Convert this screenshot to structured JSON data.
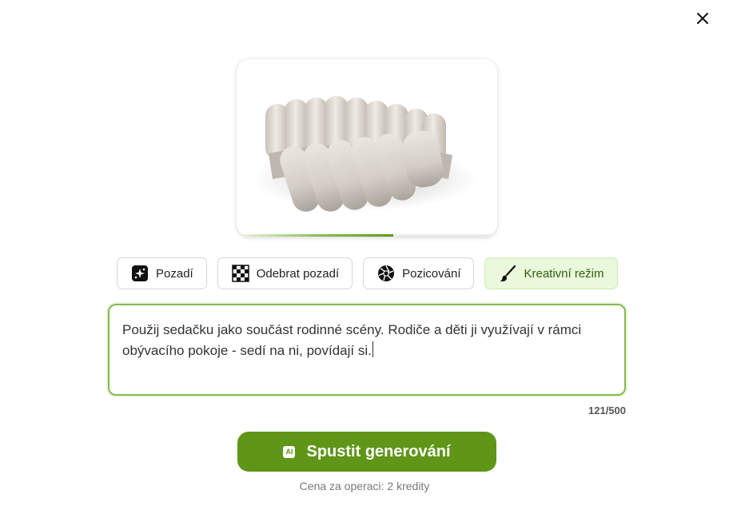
{
  "dialog": {
    "close_icon": "close-icon"
  },
  "preview": {
    "image_subject": "sofa-product-image",
    "progress": 0.6
  },
  "modes": [
    {
      "label": "Pozadí",
      "icon": "background-sparkle-icon",
      "active": false
    },
    {
      "label": "Odebrat pozadí",
      "icon": "checkerboard-icon",
      "active": false
    },
    {
      "label": "Pozicování",
      "icon": "aperture-icon",
      "active": false
    },
    {
      "label": "Kreativní režim",
      "icon": "brush-icon",
      "active": true
    }
  ],
  "prompt": {
    "value": "Použij sedačku jako součást rodinné scény. Rodiče a děti ji využívají v rámci obývacího pokoje - sedí na ni, povídají si.",
    "counter": "121/500"
  },
  "run_button": {
    "badge": "AI",
    "label": "Spustit generování"
  },
  "price_text": "Cena za operaci: 2 kredity",
  "colors": {
    "accent": "#5f9617",
    "active_bg": "#eaf8dc",
    "input_border": "#86b84f"
  }
}
